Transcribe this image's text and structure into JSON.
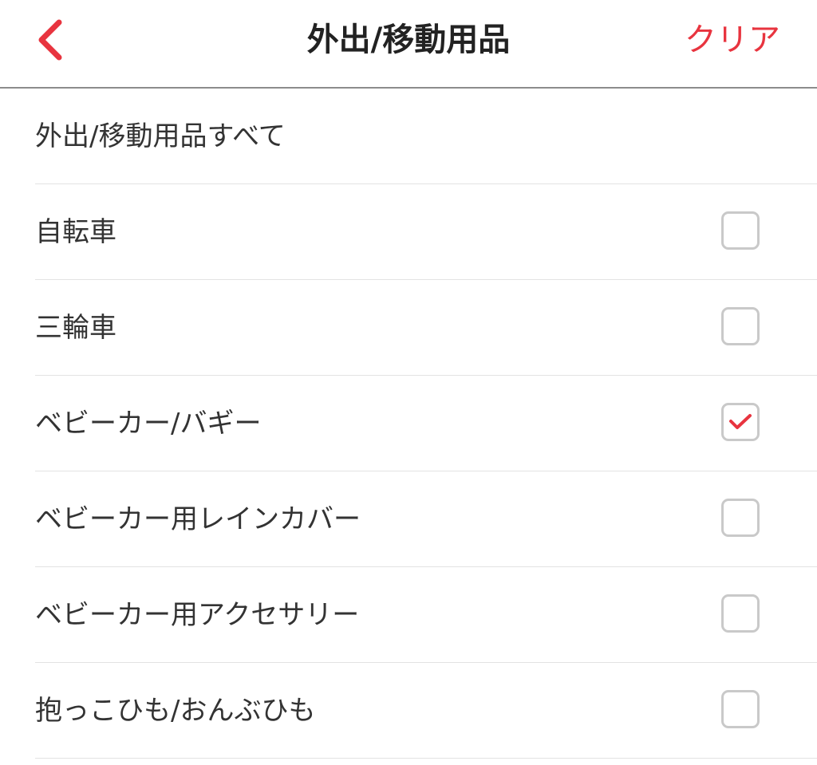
{
  "header": {
    "title": "外出/移動用品",
    "clear_label": "クリア",
    "back_icon": "chevron-left-icon",
    "accent_color": "#e8343f"
  },
  "list": {
    "all_label": "外出/移動用品すべて",
    "items": [
      {
        "label": "自転車",
        "checked": false
      },
      {
        "label": "三輪車",
        "checked": false
      },
      {
        "label": "ベビーカー/バギー",
        "checked": true
      },
      {
        "label": "ベビーカー用レインカバー",
        "checked": false
      },
      {
        "label": "ベビーカー用アクセサリー",
        "checked": false
      },
      {
        "label": "抱っこひも/おんぶひも",
        "checked": false
      }
    ]
  }
}
